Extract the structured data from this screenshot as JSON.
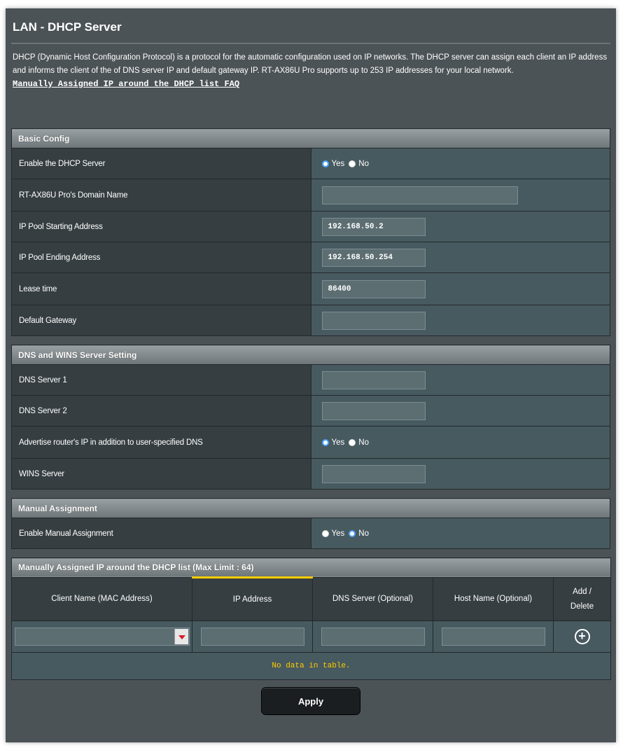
{
  "page": {
    "title": "LAN - DHCP Server",
    "description": "DHCP (Dynamic Host Configuration Protocol) is a protocol for the automatic configuration used on IP networks. The DHCP server can assign each client an IP address and informs the client of the of DNS server IP and default gateway IP. RT-AX86U Pro supports up to 253 IP addresses for your local network.",
    "faq_link": "Manually Assigned IP around the DHCP list FAQ"
  },
  "basic_config": {
    "header": "Basic Config",
    "enable_dhcp": {
      "label": "Enable the DHCP Server",
      "yes": "Yes",
      "no": "No",
      "selected": "Yes"
    },
    "domain_name": {
      "label": "RT-AX86U Pro's Domain Name",
      "value": ""
    },
    "pool_start": {
      "label": "IP Pool Starting Address",
      "value": "192.168.50.2"
    },
    "pool_end": {
      "label": "IP Pool Ending Address",
      "value": "192.168.50.254"
    },
    "lease_time": {
      "label": "Lease time",
      "value": "86400"
    },
    "default_gateway": {
      "label": "Default Gateway",
      "value": ""
    }
  },
  "dns_wins": {
    "header": "DNS and WINS Server Setting",
    "dns1": {
      "label": "DNS Server 1",
      "value": ""
    },
    "dns2": {
      "label": "DNS Server 2",
      "value": ""
    },
    "advertise": {
      "label": "Advertise router's IP in addition to user-specified DNS",
      "yes": "Yes",
      "no": "No",
      "selected": "Yes"
    },
    "wins": {
      "label": "WINS Server",
      "value": ""
    }
  },
  "manual_assignment": {
    "header": "Manual Assignment",
    "enable": {
      "label": "Enable Manual Assignment",
      "yes": "Yes",
      "no": "No",
      "selected": "No"
    }
  },
  "assigned_list": {
    "header": "Manually Assigned IP around the DHCP list (Max Limit : 64)",
    "columns": [
      "Client Name (MAC Address)",
      "IP Address",
      "DNS Server (Optional)",
      "Host Name (Optional)",
      "Add / Delete"
    ],
    "empty_text": "No data in table."
  },
  "actions": {
    "apply_label": "Apply"
  },
  "colors": {
    "panel_bg": "#4c5357",
    "label_cell": "#363e42",
    "value_cell": "#475a5f",
    "radio_selected": "#4aa3ff",
    "empty_text": "#ffcc00",
    "dropdown_arrow": "#d61f29"
  },
  "icons": {
    "add": "plus-circle-icon",
    "dropdown": "triangle-down-icon"
  }
}
